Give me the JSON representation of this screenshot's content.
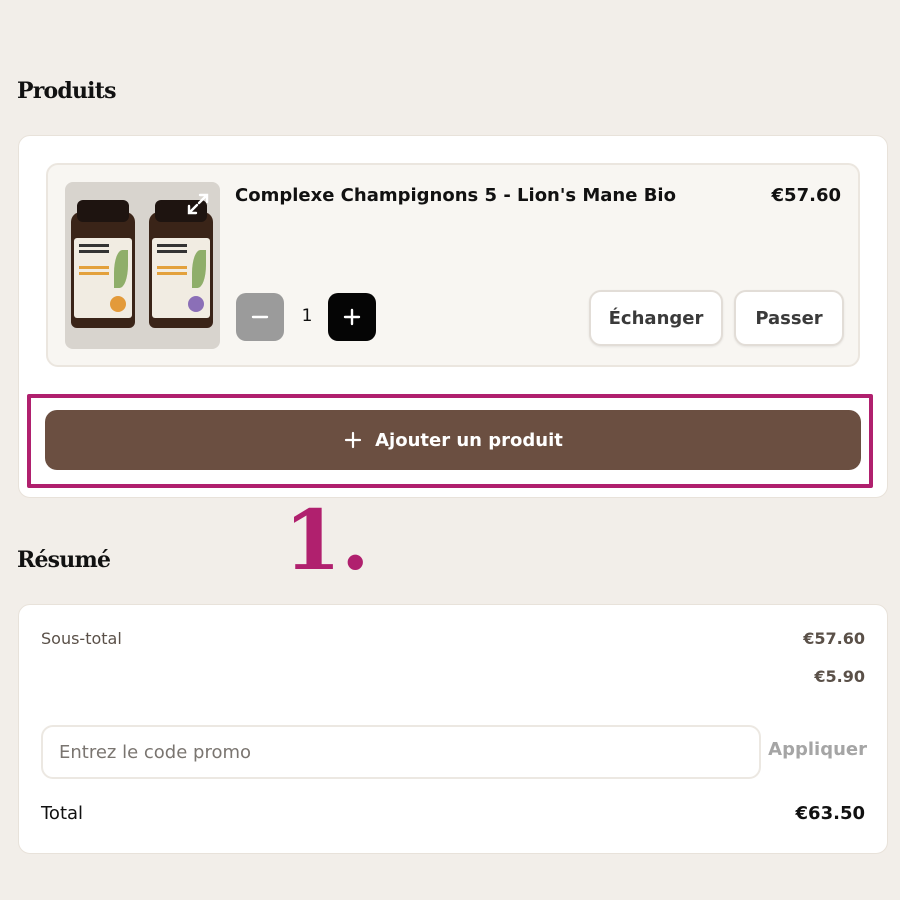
{
  "sections": {
    "products_heading": "Produits",
    "summary_heading": "Résumé"
  },
  "product": {
    "name": "Complexe Champignons 5 - Lion's Mane Bio",
    "price": "€57.60",
    "quantity": "1",
    "exchange_label": "Échanger",
    "skip_label": "Passer",
    "image_alt_icon": "expand-icon"
  },
  "add_product": {
    "label": "Ajouter un produit",
    "icon": "plus-icon"
  },
  "annotation": {
    "step_number": "1."
  },
  "summary": {
    "subtotal_label": "Sous-total",
    "subtotal_value": "€57.60",
    "shipping_value": "€5.90",
    "promo_placeholder": "Entrez le code promo",
    "promo_value": "",
    "apply_label": "Appliquer",
    "total_label": "Total",
    "total_value": "€63.50"
  },
  "colors": {
    "background": "#f2eee9",
    "add_button": "#6b4f41",
    "highlight": "#b0206e",
    "plus_button": "#050505",
    "minus_button": "#9b9b9b"
  }
}
